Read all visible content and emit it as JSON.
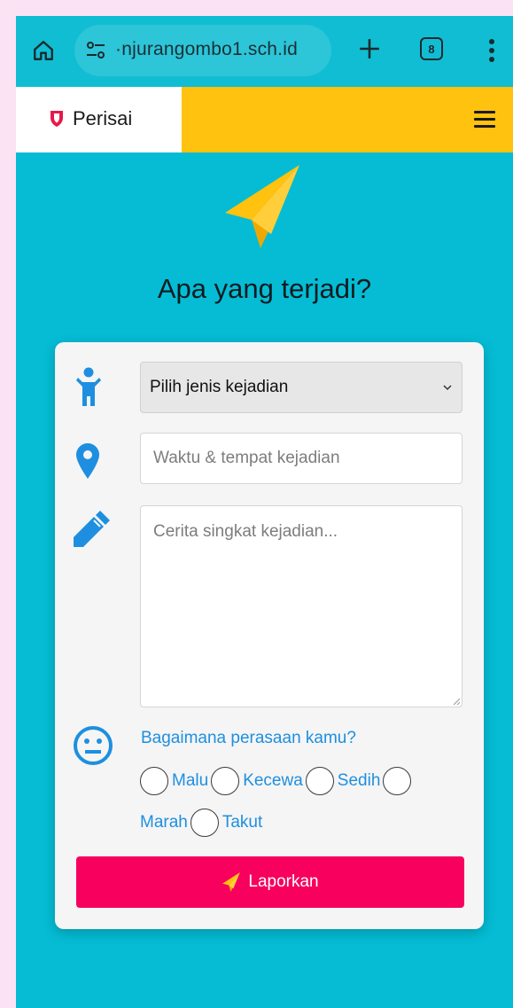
{
  "browser": {
    "url": "·njurangombo1.sch.id",
    "tab_count": "8"
  },
  "site": {
    "brand": "Perisai"
  },
  "hero": {
    "title": "Apa yang terjadi?"
  },
  "form": {
    "incident_type": {
      "selected": "Pilih jenis kejadian"
    },
    "time_place": {
      "placeholder": "Waktu & tempat kejadian"
    },
    "story": {
      "placeholder": "Cerita singkat kejadian..."
    },
    "feeling_question": "Bagaimana perasaan kamu?",
    "feelings": [
      "Malu",
      "Kecewa",
      "Sedih",
      "Marah",
      "Takut"
    ],
    "submit_label": "Laporkan"
  },
  "colors": {
    "page_bg": "#05bcd4",
    "navbar_accent": "#ffc20e",
    "icon_blue": "#1e8fe0",
    "submit_bg": "#f7005e",
    "brand_shield": "#e8184a"
  },
  "icons": [
    "home-icon",
    "site-settings-icon",
    "plus-icon",
    "tab-switcher-icon",
    "more-vert-icon",
    "shield-icon",
    "hamburger-menu-icon",
    "paper-plane-icon",
    "child-icon",
    "map-marker-icon",
    "pencil-icon",
    "neutral-face-icon",
    "chevron-down-icon"
  ]
}
